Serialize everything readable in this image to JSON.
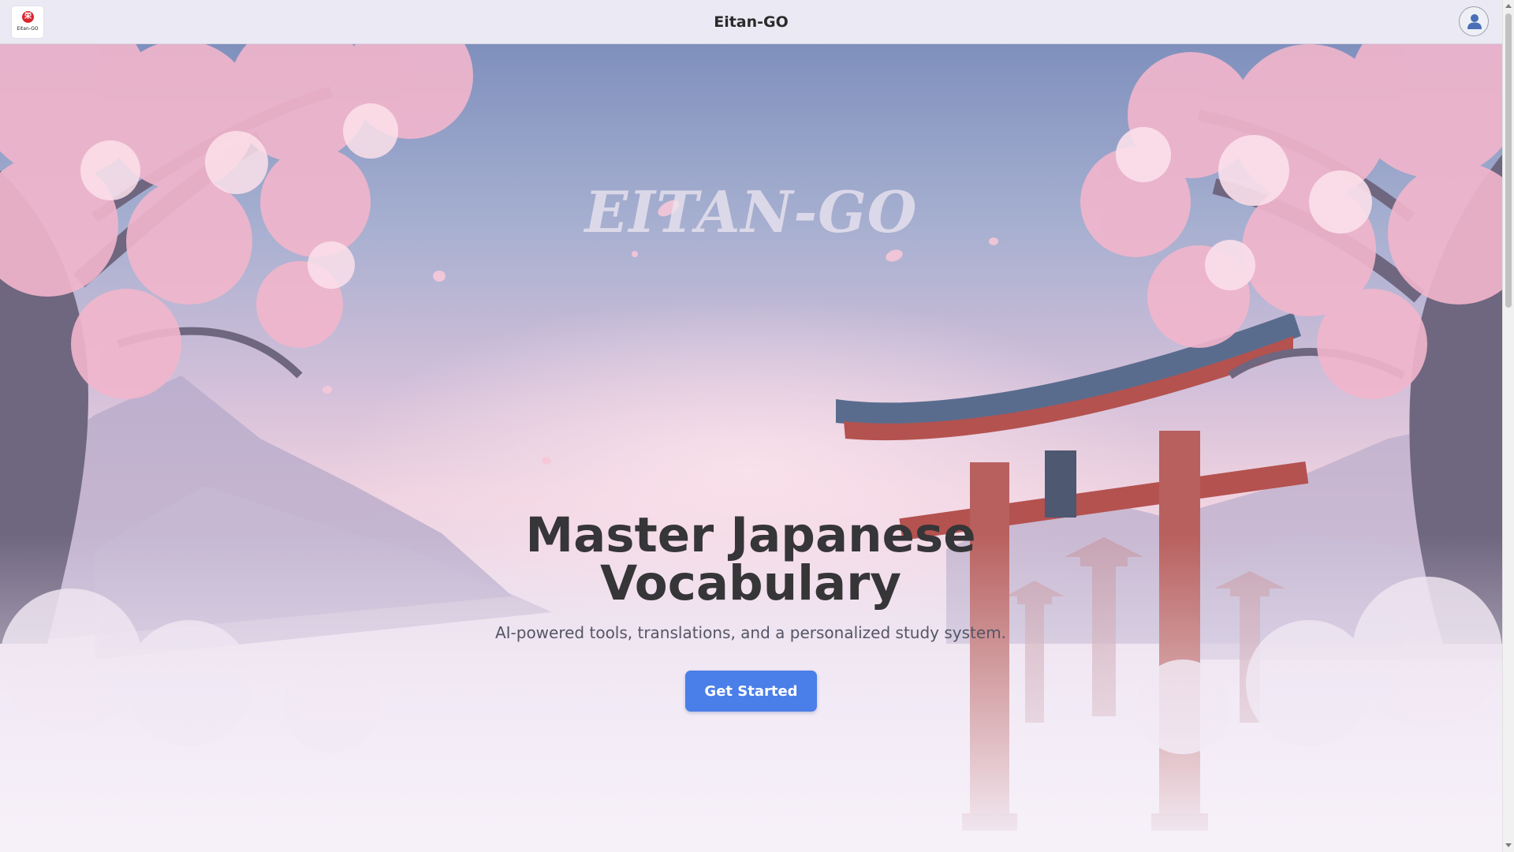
{
  "header": {
    "title": "Eitan-GO",
    "logo_glyph": "栄",
    "logo_text": "Eitan-GO",
    "user_icon": "user-icon"
  },
  "hero": {
    "watermark": "EITAN-GO",
    "headline_line1": "Master Japanese",
    "headline_line2": "Vocabulary",
    "subtitle": "AI-powered tools, translations, and a personalized study system.",
    "cta_label": "Get Started"
  },
  "colors": {
    "accent": "#4a7ee8",
    "headline": "#363538",
    "topbar": "#ebeaf4",
    "torii": "#b4524f",
    "blossom": "#f2b6cc"
  }
}
